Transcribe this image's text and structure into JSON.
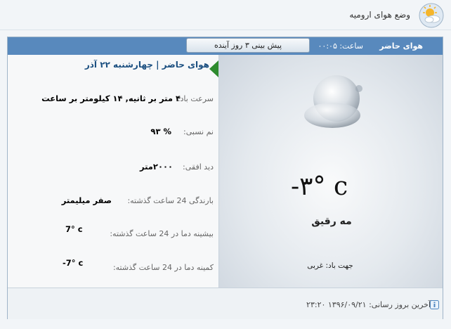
{
  "header": {
    "title": "وضع هوای ارومیه",
    "icon": "sun-cloud-icon"
  },
  "tabs": {
    "current_label": "هوای حاضر",
    "time_label": "ساعت: ۰۰:۰۵",
    "forecast_button": "پیش بینی ۳ روز آینده"
  },
  "details": {
    "date_heading": "هوای حاضر | چهارشنبه ۲۲ آذر",
    "rows": [
      {
        "label": "سرعت باد:",
        "value": "۴ متر بر ثانیه, ۱۴ کیلومتر بر ساعت"
      },
      {
        "label": "نم نسبی:",
        "value": "% ۹۳"
      },
      {
        "label": "دید افقی:",
        "value": "۲۰۰۰متر"
      },
      {
        "label": "بارندگی 24 ساعت گذشته:",
        "value": "صفر میلیمتر"
      },
      {
        "label": "بیشینه دما در 24 ساعت گذشته:",
        "value": "7° c"
      },
      {
        "label": "کمینه دما در 24 ساعت گذشته:",
        "value": "-7° c"
      }
    ]
  },
  "current": {
    "icon": "cloud-icon",
    "temperature": "-۳° c",
    "condition": "مه رقیق",
    "wind_direction": "جهت باد: غربی"
  },
  "footer": {
    "last_update": "آخرین بروز رسانی: ۱۳۹۶/۰۹/۲۱ ۲۳:۲۰",
    "icon": "info-icon"
  },
  "colors": {
    "tab_bar": "#5889bd",
    "heading_blue": "#1b4f80",
    "arrow_green": "#2e8b2e"
  }
}
